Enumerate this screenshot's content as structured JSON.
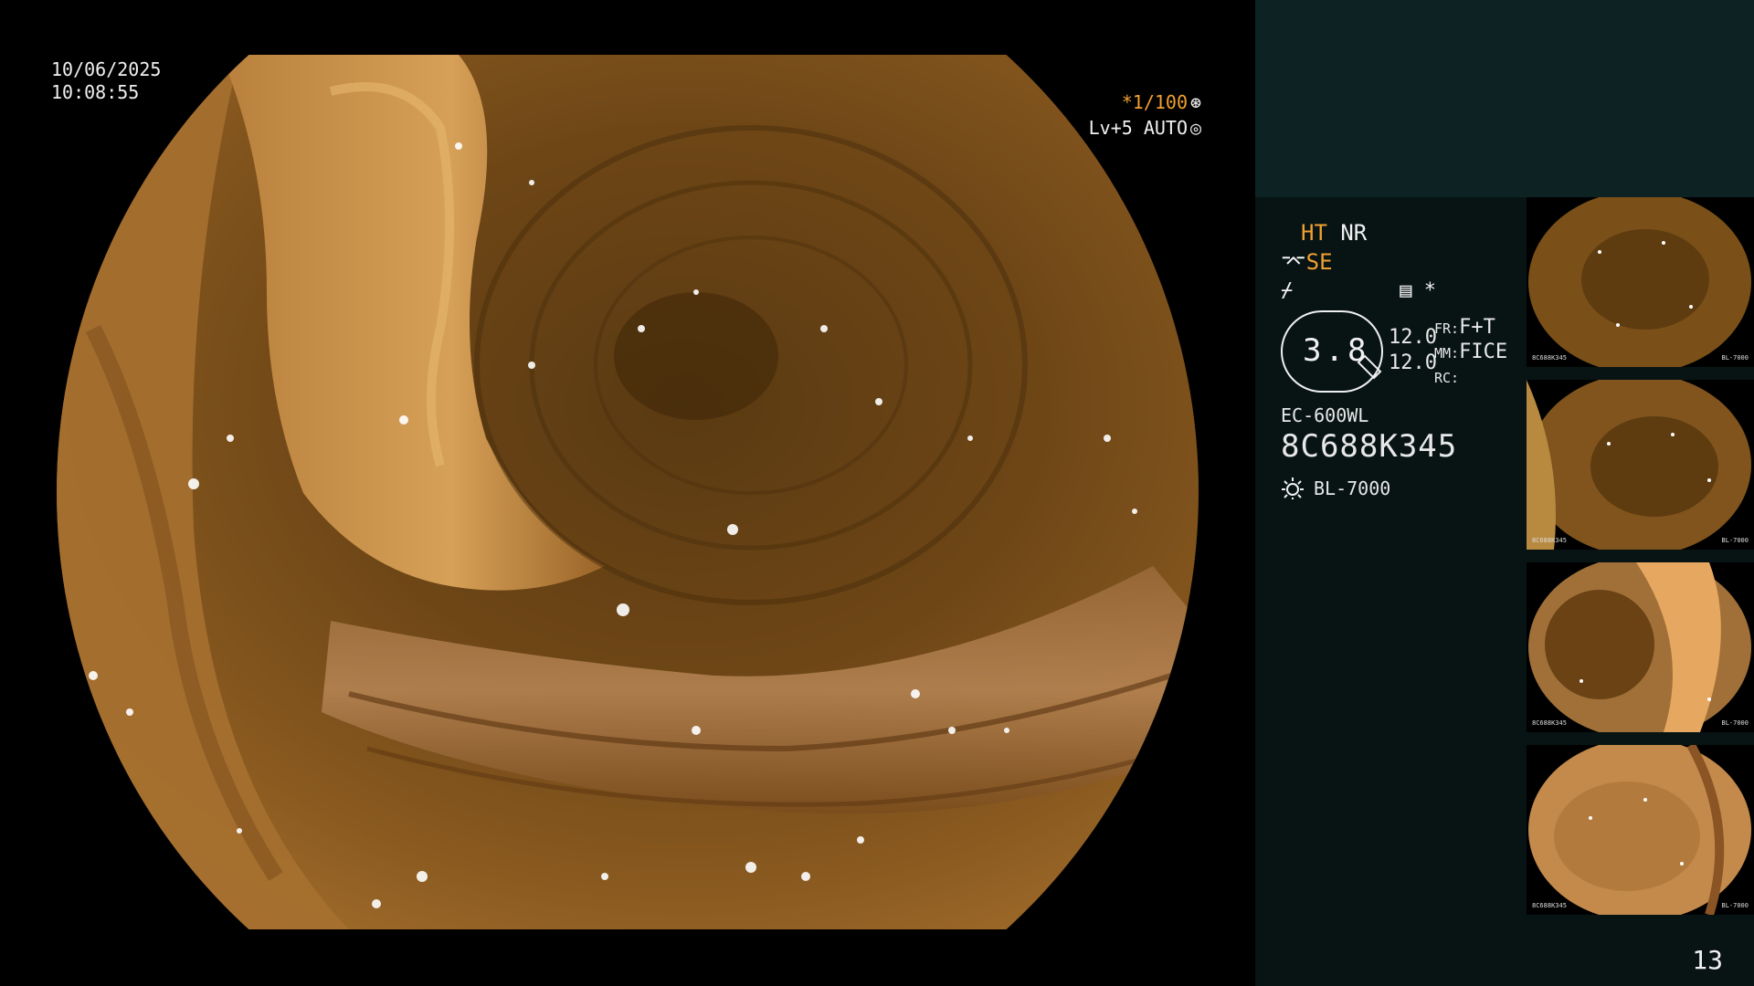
{
  "overlay": {
    "date": "10/06/2025",
    "time": "10:08:55",
    "shutter": "*1/100",
    "level": "Lv+5 AUTO"
  },
  "info": {
    "ht": "HT",
    "nr": "NR",
    "se": "SE",
    "star": "*",
    "gauge_value": "3.8",
    "zoom_top": "12.0",
    "zoom_bottom": "12.0",
    "fr_label": "FR:",
    "fr_value": "F+T",
    "mm_label": "MM:",
    "mm_value": "FICE",
    "rc_label": "RC:",
    "scope_model": "EC-600WL",
    "scope_serial": "8C688K345",
    "light_source": "BL-7000"
  },
  "thumbnails": [
    {
      "serial": "8C688K345",
      "source": "BL-7000"
    },
    {
      "serial": "8C688K345",
      "source": "BL-7000"
    },
    {
      "serial": "8C688K345",
      "source": "BL-7000"
    },
    {
      "serial": "8C688K345",
      "source": "BL-7000"
    }
  ],
  "page_number": "13",
  "colors": {
    "tissue": "#6b4312",
    "accent": "#f0a030",
    "panel_top": "#0c2223",
    "panel": "#081414"
  }
}
